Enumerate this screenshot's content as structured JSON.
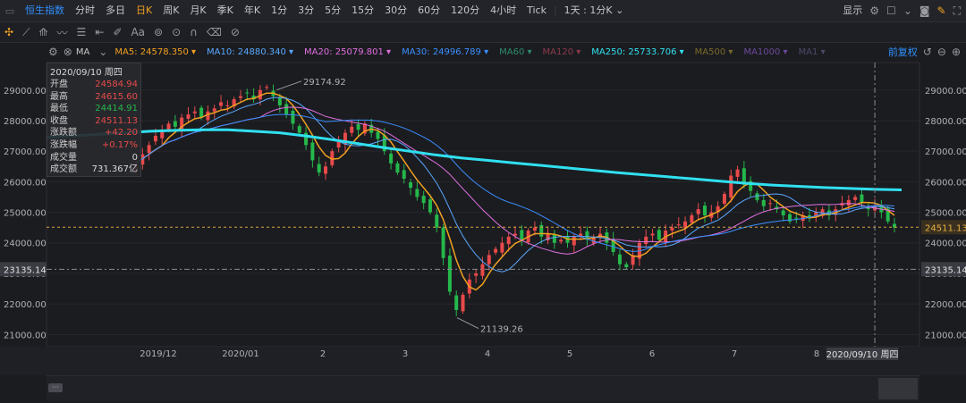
{
  "toolbar": {
    "symbol": "恒生指数",
    "timeframes": [
      "分时",
      "多日",
      "日K",
      "周K",
      "月K",
      "季K",
      "年K",
      "1分",
      "3分",
      "5分",
      "15分",
      "30分",
      "60分",
      "120分",
      "4小时",
      "Tick"
    ],
    "active_timeframe": "日K",
    "interval_select": "1天 : 1分K",
    "display_label": "显示"
  },
  "indicator_bar": {
    "label": "MA",
    "fuquan": "前复权",
    "ma": [
      {
        "name": "MA5",
        "value": "24578.350",
        "color": "#f0a020"
      },
      {
        "name": "MA10",
        "value": "24880.340",
        "color": "#5aa8ff"
      },
      {
        "name": "MA20",
        "value": "25079.801",
        "color": "#e070e0"
      },
      {
        "name": "MA30",
        "value": "24996.789",
        "color": "#3a8fff"
      },
      {
        "name": "MA60",
        "value": "",
        "color": "#2e8a6a"
      },
      {
        "name": "MA120",
        "value": "",
        "color": "#8a3a4a"
      },
      {
        "name": "MA250",
        "value": "25733.706",
        "color": "#30e0f0"
      },
      {
        "name": "MA500",
        "value": "",
        "color": "#7a6a2a"
      },
      {
        "name": "MA1000",
        "value": "",
        "color": "#6a4a9a"
      },
      {
        "name": "MA1",
        "value": "",
        "color": "#4a4a6a"
      }
    ]
  },
  "info": {
    "date": "2020/09/10 周四",
    "rows": [
      {
        "k": "开盘",
        "v": "24584.94",
        "c": "red"
      },
      {
        "k": "最高",
        "v": "24615.60",
        "c": "red"
      },
      {
        "k": "最低",
        "v": "24414.91",
        "c": "green"
      },
      {
        "k": "收盘",
        "v": "24511.13",
        "c": "red"
      },
      {
        "k": "涨跌额",
        "v": "+42.20",
        "c": "red"
      },
      {
        "k": "涨跌幅",
        "v": "+0.17%",
        "c": "red"
      },
      {
        "k": "成交量",
        "v": "0",
        "c": "white"
      },
      {
        "k": "成交额",
        "v": "731.367亿",
        "c": "white"
      }
    ]
  },
  "chart_data": {
    "type": "candlestick",
    "y_ticks": [
      21000,
      22000,
      23000,
      24000,
      25000,
      26000,
      27000,
      28000,
      29000
    ],
    "y_tick_labels": [
      "21000.00",
      "22000.00",
      "23000.00",
      "24000.00",
      "25000.00",
      "26000.00",
      "27000.00",
      "28000.00",
      "29000.00"
    ],
    "ylim": [
      20600,
      29900
    ],
    "x_labels": [
      "2019/12",
      "2020/01",
      "2",
      "3",
      "4",
      "5",
      "6",
      "7",
      "8"
    ],
    "x_label_dates": [
      "2019-12",
      "2020-01",
      "2020-02",
      "2020-03",
      "2020-04",
      "2020-05",
      "2020-06",
      "2020-07",
      "2020-08"
    ],
    "annotations": {
      "high": {
        "label": "29174.92",
        "value": 29174.92,
        "date": "2020-01"
      },
      "low": {
        "label": "21139.26",
        "value": 21139.26,
        "date": "2020-03"
      }
    },
    "current_price": {
      "label": "24511.13",
      "value": 24511.13
    },
    "crosshair_price": {
      "label": "23135.14",
      "value": 23135.14
    },
    "crosshair_date": "2020/09/10 周四",
    "closes": [
      26600,
      26900,
      27200,
      27500,
      27700,
      27900,
      27800,
      28100,
      28200,
      28300,
      28100,
      28300,
      28400,
      28600,
      28500,
      28700,
      28800,
      28900,
      28700,
      29000,
      29100,
      28800,
      28500,
      28200,
      27900,
      27600,
      27200,
      26700,
      26300,
      26500,
      27000,
      27300,
      27600,
      27800,
      27700,
      27900,
      27600,
      27400,
      27000,
      26600,
      26300,
      26100,
      25800,
      25500,
      25300,
      25000,
      24500,
      23500,
      22400,
      21800,
      22300,
      22800,
      23000,
      23300,
      23600,
      23800,
      24000,
      24200,
      24300,
      24100,
      24400,
      24500,
      24200,
      24300,
      24000,
      24100,
      24000,
      24200,
      24300,
      24100,
      24200,
      24300,
      24000,
      23700,
      23300,
      23200,
      23600,
      24000,
      24200,
      24300,
      24100,
      24400,
      24500,
      24600,
      24700,
      24900,
      25100,
      24900,
      25000,
      25200,
      25600,
      26200,
      26400,
      25900,
      25700,
      25400,
      25200,
      25300,
      25100,
      24900,
      24700,
      24800,
      24900,
      24800,
      25000,
      25100,
      24900,
      25100,
      25300,
      25400,
      25500,
      25300,
      25100,
      25200,
      25000,
      24700,
      24500
    ],
    "ma250": [
      27450,
      27500,
      27550,
      27600,
      27650,
      27680,
      27700,
      27700,
      27650,
      27600,
      27500,
      27380,
      27250,
      27120,
      27000,
      26880,
      26780,
      26700,
      26620,
      26540,
      26460,
      26380,
      26300,
      26230,
      26160,
      26090,
      26020,
      25950,
      25890,
      25850,
      25810,
      25780,
      25750,
      25733
    ]
  }
}
